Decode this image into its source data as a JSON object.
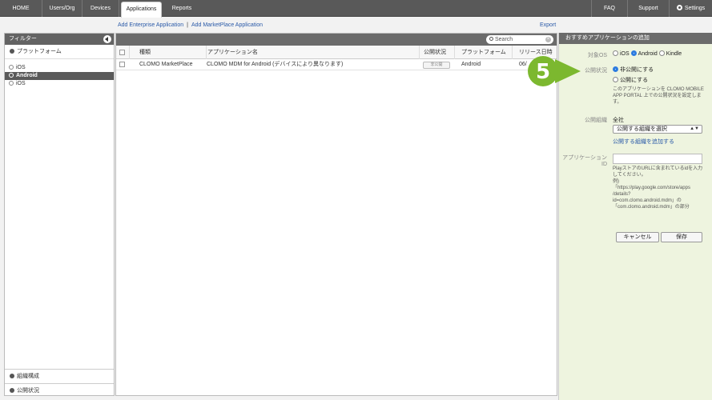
{
  "nav": {
    "tabs": [
      "HOME",
      "Users/Org",
      "Devices",
      "Applications",
      "Reports"
    ],
    "active_tab": "Applications",
    "right": [
      "FAQ",
      "Support",
      "Settings"
    ]
  },
  "links": {
    "add_enterprise": "Add Enterprise Application",
    "separator": "|",
    "add_marketplace": "Add MarketPlace Application",
    "export": "Export"
  },
  "sidebar": {
    "title": "フィルター",
    "platform_section": "プラットフォーム",
    "items": [
      "iOS",
      "Android",
      "iOS"
    ],
    "selected": "Android",
    "bottom_sections": [
      "組織構成",
      "公開状況"
    ]
  },
  "table": {
    "search_placeholder": "Search",
    "columns": [
      "種類",
      "アプリケーション名",
      "公開状況",
      "プラットフォーム",
      "リリース日時"
    ],
    "rows": [
      {
        "type": "CLOMO MarketPlace",
        "name": "CLOMO MDM for Android (デバイスにより異なります)",
        "status": "非公開",
        "platform": "Android",
        "release": "06/"
      }
    ]
  },
  "panel": {
    "title": "おすすめアプリケーションの追加",
    "os_label": "対象OS",
    "os_options": [
      "iOS",
      "Android",
      "Kindle"
    ],
    "os_selected": "Android",
    "status_label": "公開状況",
    "status_options": [
      "非公開にする",
      "公開にする"
    ],
    "status_selected": "非公開にする",
    "status_desc_1": "このアプリケーションを CLOMO MOBILE",
    "status_desc_2": "APP PORTAL 上での公開状況を設定しま",
    "status_desc_3": "す。",
    "org_label": "公開組織",
    "org_value": "全社",
    "org_select": "公開する組織を選択",
    "org_add_link": "公開する組織を追加する",
    "app_id_label_1": "アプリケーション",
    "app_id_label_2": "ID",
    "app_id_desc": [
      "PlayストアのURLに含まれているidを入力",
      "してください。",
      "例)",
      "「https://play.google.com/store/apps",
      "/details?",
      "id=com.clomo.android.mdm」の",
      "「com.clomo.android.mdm」の部分"
    ],
    "cancel": "キャンセル",
    "save": "保存"
  },
  "step": {
    "number": "5",
    "color": "#7cb82f"
  }
}
